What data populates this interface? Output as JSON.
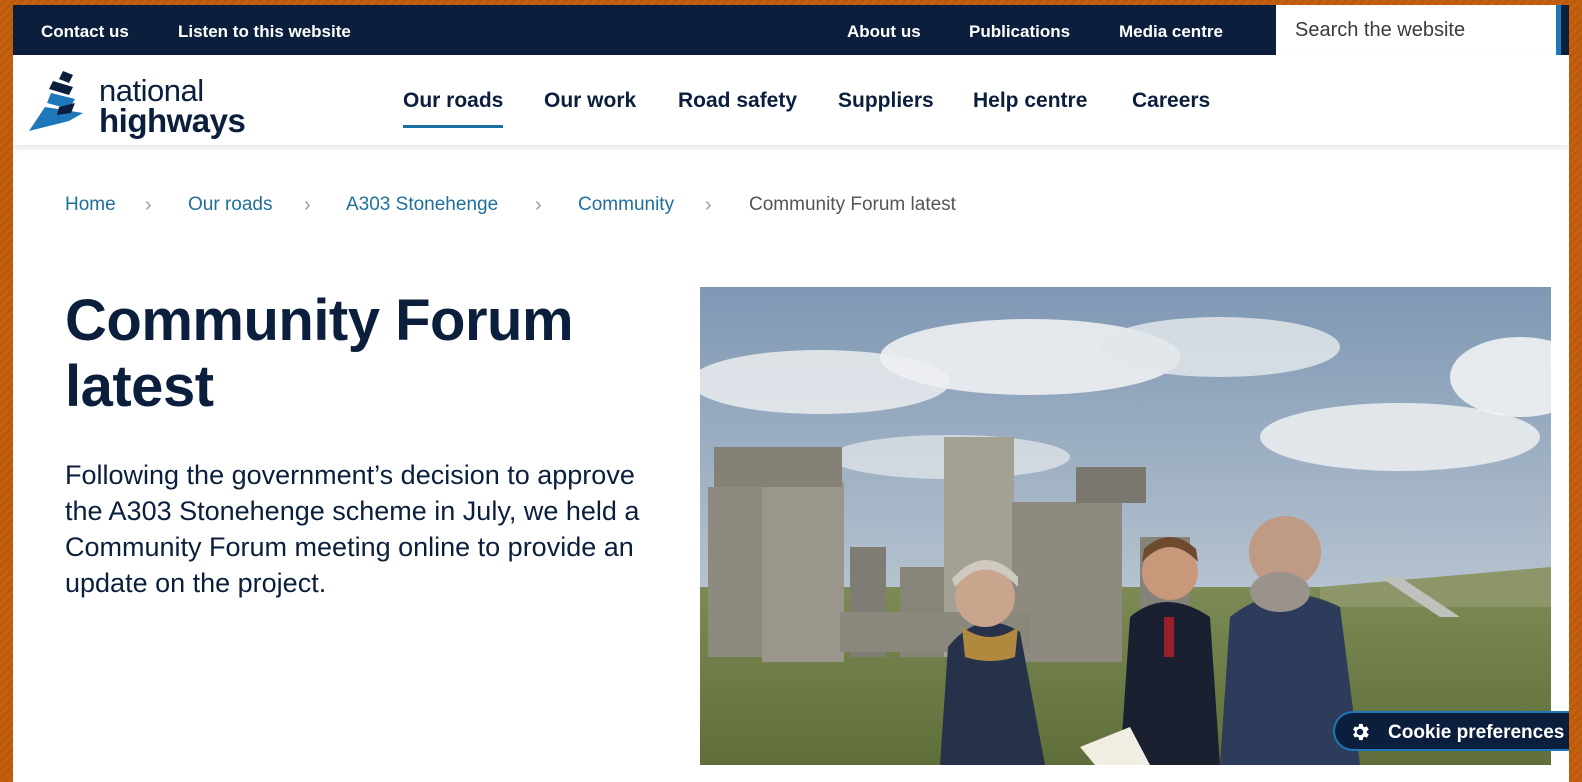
{
  "utility_bar": {
    "contact_us": "Contact us",
    "listen": "Listen to this website",
    "about_us": "About us",
    "publications": "Publications",
    "media_centre": "Media centre",
    "search_placeholder": "Search the website"
  },
  "logo": {
    "line1": "national",
    "line2": "highways"
  },
  "nav": {
    "our_roads": "Our roads",
    "our_work": "Our work",
    "road_safety": "Road safety",
    "suppliers": "Suppliers",
    "help_centre": "Help centre",
    "careers": "Careers",
    "active": "Our roads"
  },
  "breadcrumb": {
    "home": "Home",
    "our_roads": "Our roads",
    "stonehenge": "A303 Stonehenge",
    "community": "Community",
    "current": "Community Forum latest",
    "separator": ">"
  },
  "page": {
    "title": "Community Forum latest",
    "lead": "Following the government’s decision to approve the A303 Stonehenge scheme in July, we held a Community Forum meeting online to provide an update on the project."
  },
  "cookie": {
    "label": "Cookie preferences",
    "icon": "gear-icon"
  },
  "colors": {
    "navy": "#0b1f3d",
    "link": "#1f6f9d",
    "accent": "#1d77b8"
  }
}
